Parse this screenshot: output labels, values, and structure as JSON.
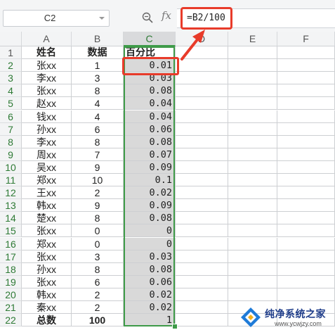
{
  "formula_bar": {
    "name_box": "C2",
    "fx_label": "fx",
    "formula": "=B2/100"
  },
  "columns": [
    "A",
    "B",
    "C",
    "D",
    "E",
    "F"
  ],
  "rows": [
    {
      "num": "1",
      "a": "姓名",
      "b": "数据",
      "c": "百分比"
    },
    {
      "num": "2",
      "a": "张xx",
      "b": "1",
      "c": "0.01"
    },
    {
      "num": "3",
      "a": "李xx",
      "b": "3",
      "c": "0.03"
    },
    {
      "num": "4",
      "a": "张xx",
      "b": "8",
      "c": "0.08"
    },
    {
      "num": "5",
      "a": "赵xx",
      "b": "4",
      "c": "0.04"
    },
    {
      "num": "6",
      "a": "钱xx",
      "b": "4",
      "c": "0.04"
    },
    {
      "num": "7",
      "a": "孙xx",
      "b": "6",
      "c": "0.06"
    },
    {
      "num": "8",
      "a": "李xx",
      "b": "8",
      "c": "0.08"
    },
    {
      "num": "9",
      "a": "周xx",
      "b": "7",
      "c": "0.07"
    },
    {
      "num": "10",
      "a": "吴xx",
      "b": "9",
      "c": "0.09"
    },
    {
      "num": "11",
      "a": "郑xx",
      "b": "10",
      "c": "0.1"
    },
    {
      "num": "12",
      "a": "王xx",
      "b": "2",
      "c": "0.02"
    },
    {
      "num": "13",
      "a": "韩xx",
      "b": "9",
      "c": "0.09"
    },
    {
      "num": "14",
      "a": "楚xx",
      "b": "8",
      "c": "0.08"
    },
    {
      "num": "15",
      "a": "张xx",
      "b": "0",
      "c": "0"
    },
    {
      "num": "16",
      "a": "郑xx",
      "b": "0",
      "c": "0"
    },
    {
      "num": "17",
      "a": "张xx",
      "b": "3",
      "c": "0.03"
    },
    {
      "num": "18",
      "a": "孙xx",
      "b": "8",
      "c": "0.08"
    },
    {
      "num": "19",
      "a": "张xx",
      "b": "6",
      "c": "0.06"
    },
    {
      "num": "20",
      "a": "韩xx",
      "b": "2",
      "c": "0.02"
    },
    {
      "num": "21",
      "a": "秦xx",
      "b": "2",
      "c": "0.02"
    },
    {
      "num": "22",
      "a": "总数",
      "b": "100",
      "c": "1"
    }
  ],
  "watermark": {
    "title": "纯净系统之家",
    "url": "www.ycwjzy.com"
  },
  "colors": {
    "selection": "#3f9b49",
    "highlight": "#e83b2a",
    "selected_fill": "#d9d9d9"
  }
}
